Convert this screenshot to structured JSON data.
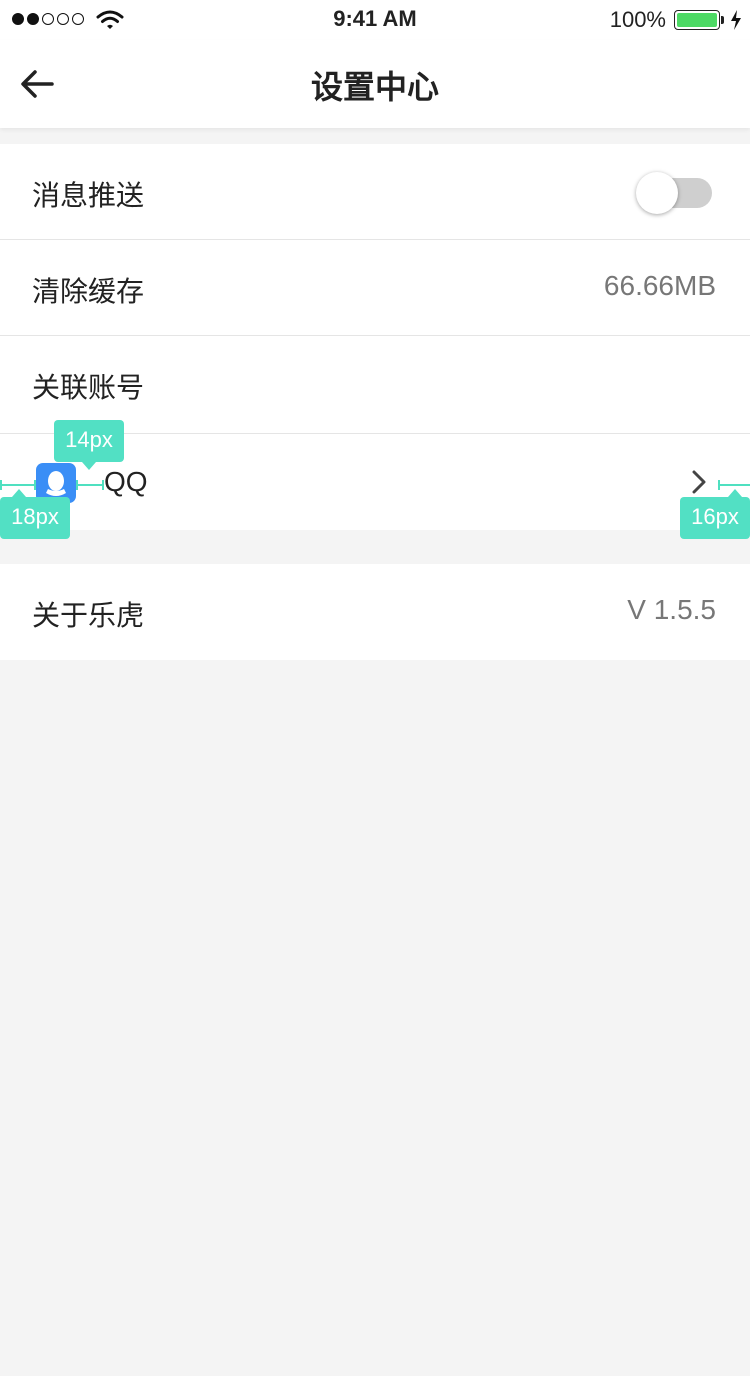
{
  "status_bar": {
    "time": "9:41 AM",
    "battery_percent": "100%",
    "battery_color": "#4cd964",
    "signal_strength": 2,
    "icons": [
      "signal-dots",
      "wifi-icon",
      "battery-icon",
      "charging-bolt-icon"
    ]
  },
  "navbar": {
    "title": "设置中心",
    "back_icon": "arrow-left-icon"
  },
  "settings": {
    "push": {
      "label": "消息推送",
      "enabled": false
    },
    "cache": {
      "label": "清除缓存",
      "value": "66.66MB"
    },
    "linked_accounts": {
      "label": "关联账号"
    },
    "qq": {
      "label": "QQ",
      "icon": "qq-icon",
      "chevron": "chevron-right-icon"
    },
    "about": {
      "label": "关于乐虎",
      "value": "V 1.5.5"
    }
  },
  "annotations": {
    "left_margin": "18px",
    "icon_gap": "14px",
    "right_margin": "16px",
    "color": "#52e0c4"
  }
}
